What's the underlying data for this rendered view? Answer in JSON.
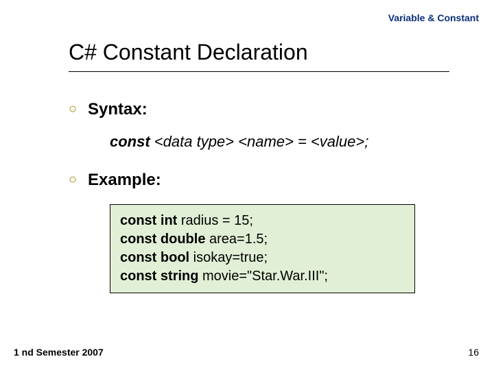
{
  "header": "Variable & Constant",
  "title": "C# Constant Declaration",
  "bullets": {
    "syntax_label": "Syntax:",
    "example_label": "Example:"
  },
  "syntax": {
    "keyword": "const",
    "rest": " <data type> <name> = <value>;"
  },
  "examples": [
    {
      "const": "const",
      "type": "int",
      "rest": " radius = 15;"
    },
    {
      "const": "const",
      "type": "double",
      "rest": " area=1.5;"
    },
    {
      "const": "const",
      "type": "bool",
      "rest": " isokay=true;"
    },
    {
      "const": "const",
      "type": "string",
      "rest": " movie=\"Star.War.III\";"
    }
  ],
  "footer": {
    "left": "1 nd Semester 2007",
    "page": "16"
  }
}
